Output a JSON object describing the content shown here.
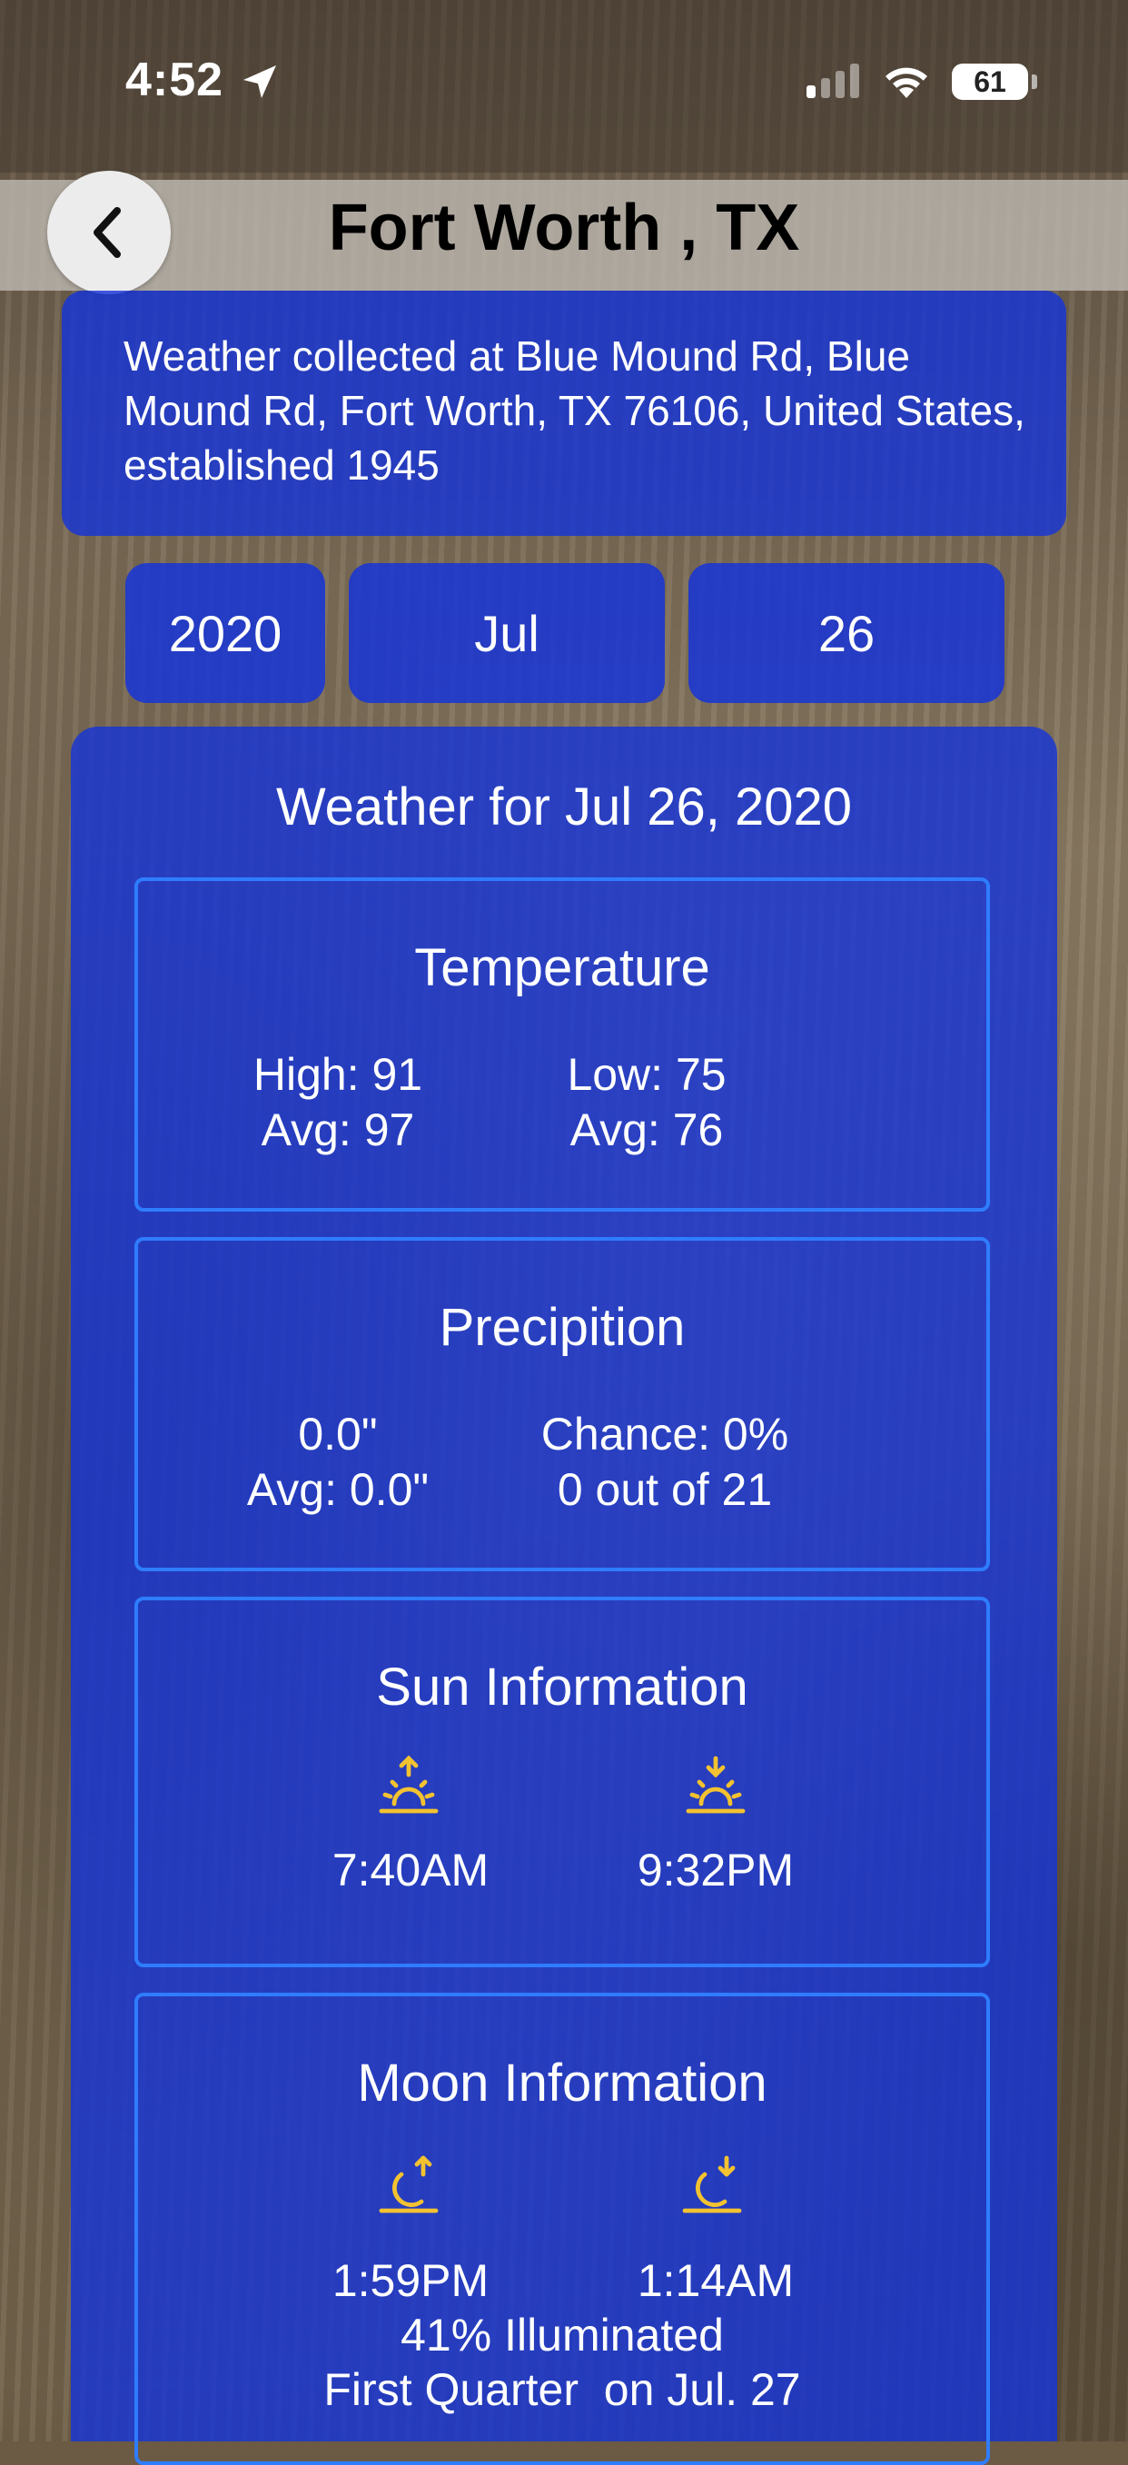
{
  "status_bar": {
    "time": "4:52",
    "battery": "61",
    "icons": [
      "location-arrow-icon",
      "cellular-signal-icon",
      "wifi-icon",
      "battery-icon"
    ]
  },
  "nav": {
    "title": "Fort Worth , TX",
    "back_icon": "chevron-left-icon"
  },
  "station": {
    "description": "Weather collected at Blue Mound Rd, Blue Mound Rd, Fort Worth, TX  76106, United States, established 1945"
  },
  "date_picker": {
    "year": "2020",
    "month": "Jul",
    "day": "26"
  },
  "weather": {
    "title": "Weather for Jul 26, 2020",
    "temperature": {
      "title": "Temperature",
      "high": "High: 91",
      "low": "Low: 75",
      "high_avg": "Avg: 97",
      "low_avg": "Avg: 76"
    },
    "precipitation": {
      "title": "Precipition",
      "amount": "0.0\"",
      "chance": "Chance: 0%",
      "avg": "Avg: 0.0\"",
      "history": "0 out of 21"
    },
    "sun": {
      "title": "Sun Information",
      "sunrise": "7:40AM",
      "sunset": "9:32PM",
      "icon_color": "#f2c230"
    },
    "moon": {
      "title": "Moon Information",
      "moonrise": "1:59PM",
      "moonset": "1:14AM",
      "illumination": "41% Illuminated",
      "next_phase": "First Quarter  on Jul. 27",
      "icon_color": "#f2c230"
    }
  },
  "colors": {
    "card_blue": "#1634d7",
    "box_border": "#2f7dff"
  }
}
